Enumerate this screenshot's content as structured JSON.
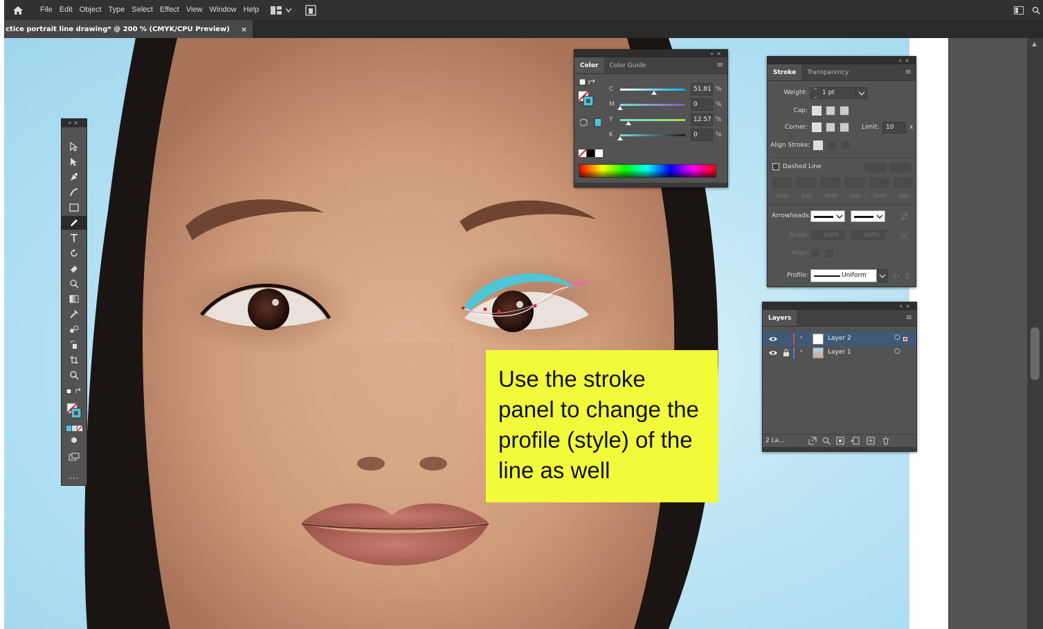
{
  "menubar": {
    "items": [
      "File",
      "Edit",
      "Object",
      "Type",
      "Select",
      "Effect",
      "View",
      "Window",
      "Help"
    ]
  },
  "document_tab": {
    "title": "ctice portrait line drawing* @ 200 % (CMYK/CPU Preview)",
    "close": "×"
  },
  "toolbox": {
    "more": "..."
  },
  "color_panel": {
    "tabs": [
      "Color",
      "Color Guide"
    ],
    "sliders": [
      {
        "name": "C",
        "value": "51.81",
        "unit": "%",
        "level": 0.5181
      },
      {
        "name": "M",
        "value": "0",
        "unit": "%",
        "level": 0
      },
      {
        "name": "Y",
        "value": "12.57",
        "unit": "%",
        "level": 0.1257
      },
      {
        "name": "K",
        "value": "0",
        "unit": "%",
        "level": 0
      }
    ],
    "fill_color": "#4fc6d6"
  },
  "stroke_panel": {
    "tabs": [
      "Stroke",
      "Transparency"
    ],
    "weight_label": "Weight:",
    "weight_value": "1 pt",
    "cap_label": "Cap:",
    "corner_label": "Corner:",
    "limit_label": "Limit:",
    "limit_value": "10",
    "limit_unit": "x",
    "align_label": "Align Stroke:",
    "dashed_label": "Dashed Line",
    "dash_labels": [
      "dash",
      "gap",
      "dash",
      "gap",
      "dash",
      "gap"
    ],
    "arrowheads_label": "Arrowheads:",
    "scale_label": "Scale:",
    "scale_values": [
      "100%",
      "100%"
    ],
    "align_arrow_label": "Align:",
    "profile_label": "Profile:",
    "profile_value": "Uniform"
  },
  "layers_panel": {
    "tabs": [
      "Layers"
    ],
    "layers": [
      {
        "name": "Layer 2",
        "color": "#e04848",
        "selected": true,
        "locked": false
      },
      {
        "name": "Layer 1",
        "color": "#4a7fe0",
        "selected": false,
        "locked": true
      }
    ],
    "count": "2 La..."
  },
  "canvas": {
    "anchor_label": "anchor",
    "stroke_color": "#4fc6d6"
  },
  "callout": {
    "text": "Use the stroke panel to change the profile (style) of the line as well"
  }
}
